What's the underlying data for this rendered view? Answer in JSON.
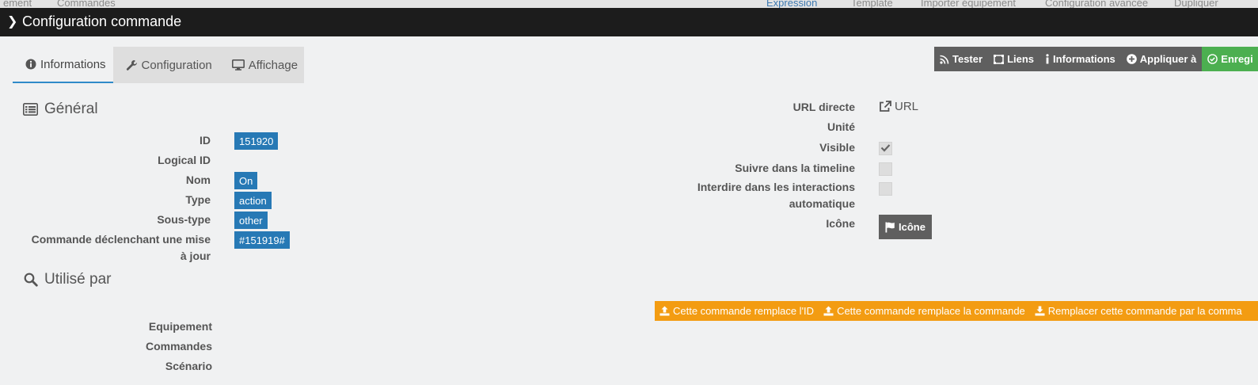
{
  "background": {
    "items": [
      "ement",
      "Commandes",
      "Expression",
      "Template",
      "Importer équipement",
      "Configuration avancée",
      "Dupliquer"
    ]
  },
  "title": "Configuration commande",
  "tabs": [
    {
      "label": "Informations",
      "icon": "info-circle-icon"
    },
    {
      "label": "Configuration",
      "icon": "wrench-icon"
    },
    {
      "label": "Affichage",
      "icon": "monitor-icon"
    }
  ],
  "actions": {
    "tester": "Tester",
    "liens": "Liens",
    "informations": "Informations",
    "appliquer": "Appliquer à",
    "enregistrer": "Enregi"
  },
  "general": {
    "heading": "Général",
    "fields": {
      "id_label": "ID",
      "id_value": "151920",
      "logical_id_label": "Logical ID",
      "nom_label": "Nom",
      "nom_value": "On",
      "type_label": "Type",
      "type_value": "action",
      "soustype_label": "Sous-type",
      "soustype_value": "other",
      "maj_label_1": "Commande déclenchant une mise",
      "maj_label_2": "à jour",
      "maj_value": "#151919#"
    }
  },
  "right": {
    "url_label": "URL directe",
    "url_link": "URL",
    "unite_label": "Unité",
    "visible_label": "Visible",
    "visible_checked": true,
    "timeline_label": "Suivre dans la timeline",
    "interdire_label_1": "Interdire dans les interactions",
    "interdire_label_2": "automatique",
    "icone_label": "Icône",
    "icone_button": "Icône"
  },
  "used_by": {
    "heading": "Utilisé par",
    "equipement_label": "Equipement",
    "commandes_label": "Commandes",
    "scenario_label": "Scénario"
  },
  "replace": {
    "btn1": "Cette commande remplace l'ID",
    "btn2": "Cette commande remplace la commande",
    "btn3": "Remplacer cette commande par la comma"
  },
  "colors": {
    "primary": "#2779b5",
    "dark_button": "#5f5f5f",
    "success": "#4caf50",
    "warning": "#f39c12"
  }
}
